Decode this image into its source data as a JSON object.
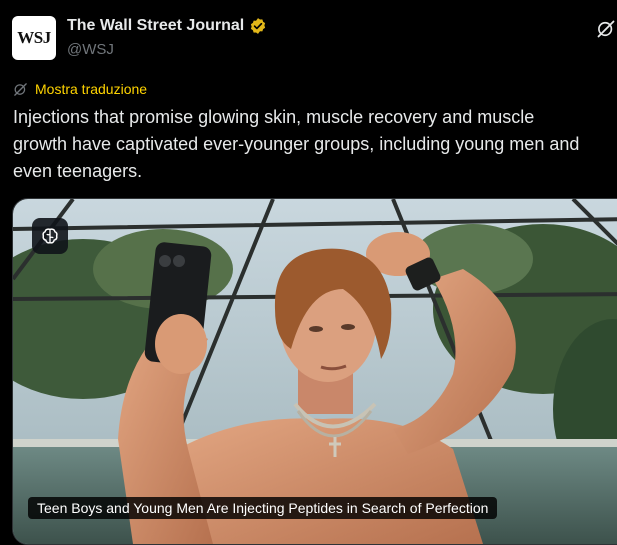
{
  "author": {
    "avatar_text": "WSJ",
    "display_name": "The Wall Street Journal",
    "handle": "@WSJ",
    "verified_color": "#e2b719"
  },
  "translate": {
    "label": "Mostra traduzione",
    "color": "#ffd400"
  },
  "tweet": {
    "text": "Injections that promise glowing skin, muscle recovery and muscle\ngrowth have captivated ever-younger groups, including young men and\neven teenagers."
  },
  "media": {
    "caption": "Teen Boys and Young Men Are Injecting Peptides in Search of Perfection"
  },
  "icons": {
    "grok": "grok-icon",
    "translate": "translate-icon",
    "audio": "brain-icon",
    "verified": "verified-badge-icon"
  }
}
